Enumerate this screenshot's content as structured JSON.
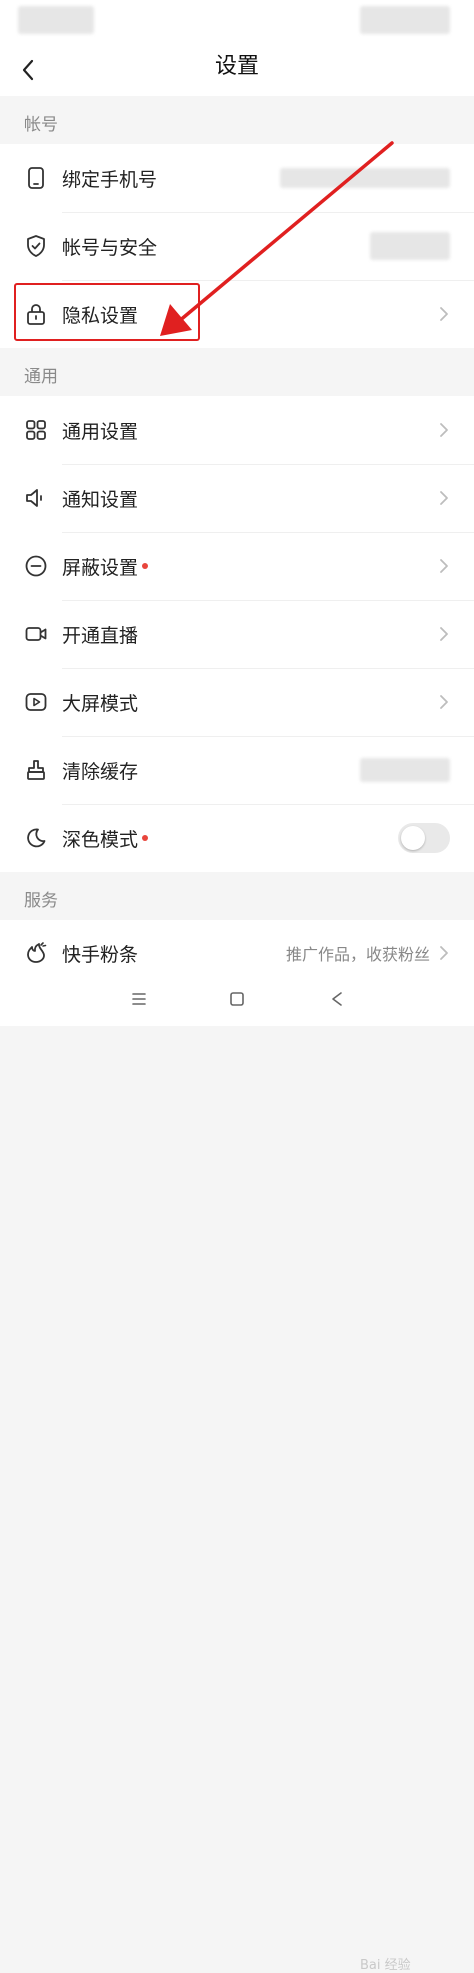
{
  "header": {
    "title": "设置"
  },
  "sections": [
    {
      "label": "帐号",
      "items": [
        {
          "label": "绑定手机号",
          "icon": "phone-icon"
        },
        {
          "label": "帐号与安全",
          "icon": "shield-icon"
        },
        {
          "label": "隐私设置",
          "icon": "lock-icon"
        }
      ]
    },
    {
      "label": "通用",
      "items": [
        {
          "label": "通用设置",
          "icon": "grid-icon"
        },
        {
          "label": "通知设置",
          "icon": "speaker-icon"
        },
        {
          "label": "屏蔽设置",
          "icon": "block-icon",
          "badge": true
        },
        {
          "label": "开通直播",
          "icon": "video-camera-icon"
        },
        {
          "label": "大屏模式",
          "icon": "play-screen-icon"
        },
        {
          "label": "清除缓存",
          "icon": "broom-icon"
        },
        {
          "label": "深色模式",
          "icon": "moon-icon",
          "badge": true,
          "toggle_on": false
        }
      ]
    },
    {
      "label": "服务",
      "items": [
        {
          "label": "快手粉条",
          "icon": "fan-boost-icon",
          "value": "推广作品，收获粉丝"
        }
      ]
    }
  ],
  "annotation": {
    "highlight_color": "#e02020"
  },
  "watermark": "Bai 经验",
  "colors": {
    "badge": "#e8453c",
    "section_label": "#8a8a8a",
    "background": "#f5f5f5"
  }
}
